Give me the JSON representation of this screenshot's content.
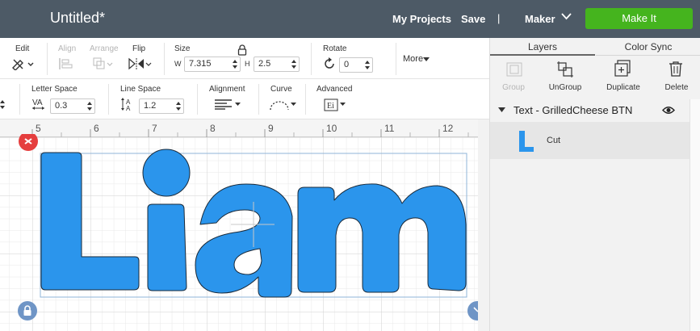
{
  "header": {
    "doc_title": "Untitled*",
    "my_projects": "My Projects",
    "save": "Save",
    "separator": "|",
    "machine": "Maker",
    "make_it": "Make It"
  },
  "toolbar1": {
    "edit": "Edit",
    "align": "Align",
    "arrange": "Arrange",
    "flip": "Flip",
    "size": "Size",
    "w_label": "W",
    "width": "7.315",
    "h_label": "H",
    "height": "2.5",
    "rotate": "Rotate",
    "rotation": "0",
    "more": "More"
  },
  "toolbar2": {
    "letter_space": "Letter Space",
    "letter_space_value": "0.3",
    "line_space": "Line Space",
    "line_space_value": "1.2",
    "alignment": "Alignment",
    "curve": "Curve",
    "advanced": "Advanced"
  },
  "ruler": {
    "ticks": [
      "5",
      "6",
      "7",
      "8",
      "9",
      "10",
      "11",
      "12"
    ]
  },
  "canvas": {
    "text": "Liam",
    "fill_color": "#2b95ec"
  },
  "panel": {
    "tabs": [
      "Layers",
      "Color Sync"
    ],
    "tools": [
      "Group",
      "UnGroup",
      "Duplicate",
      "Delete"
    ],
    "layer_title": "Text - GrilledCheese BTN",
    "layer_child": "Cut"
  },
  "colors": {
    "topbar": "#4d5a66",
    "make_it": "#45b41e",
    "accent_blue": "#2b95ec"
  }
}
